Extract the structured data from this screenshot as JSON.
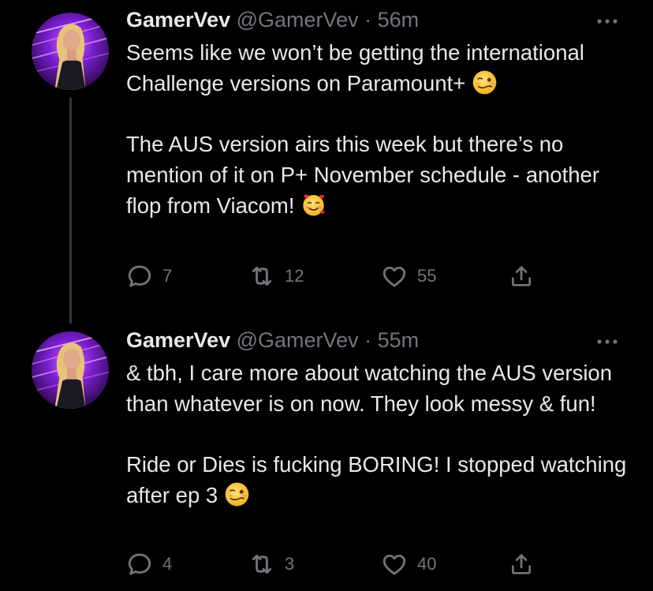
{
  "tweets": [
    {
      "name": "GamerVev",
      "handle": "@GamerVev",
      "separator": "·",
      "time": "56m",
      "paragraphs": [
        "Seems like we won’t be getting the international Challenge versions on Paramount+",
        "The AUS version airs this week but there’s no mention of it on P+ November schedule - another flop from Viacom!"
      ],
      "emojis": [
        "woozy-face",
        "smiling-face-with-hearts"
      ],
      "replies": "7",
      "retweets": "12",
      "likes": "55"
    },
    {
      "name": "GamerVev",
      "handle": "@GamerVev",
      "separator": "·",
      "time": "55m",
      "paragraphs": [
        "& tbh, I care more about watching the AUS version than whatever is on now. They look messy & fun!",
        "Ride or Dies is fucking BORING! I stopped watching after ep 3"
      ],
      "emojis": [
        "woozy-face"
      ],
      "replies": "4",
      "retweets": "3",
      "likes": "40"
    }
  ],
  "icons": {
    "more": "more-horizontal-icon",
    "reply": "reply-icon",
    "retweet": "retweet-icon",
    "like": "heart-icon",
    "share": "share-icon"
  },
  "colors": {
    "background": "#000000",
    "text": "#e7e9ea",
    "secondary": "#71767b",
    "thread_line": "#333639",
    "avatar_glow": "#b04dff"
  }
}
